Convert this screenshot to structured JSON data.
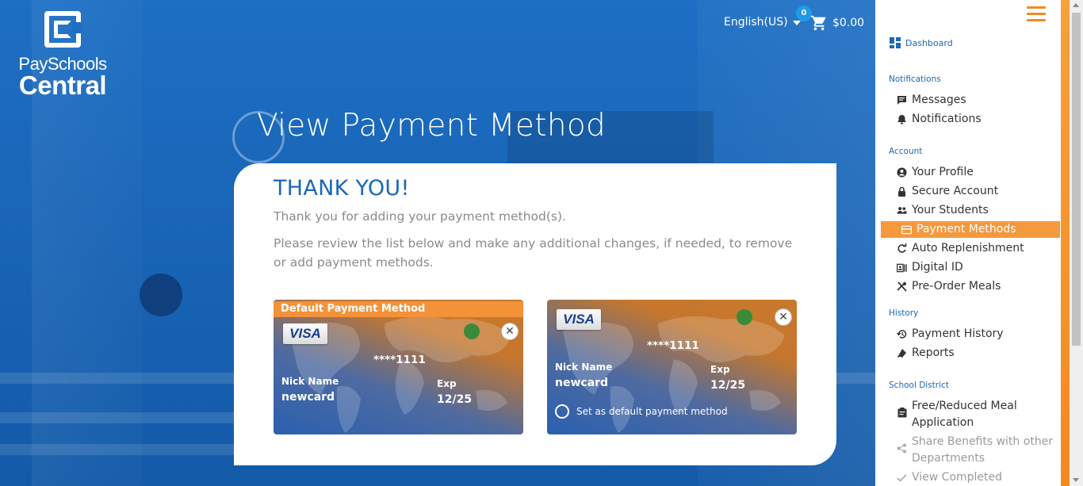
{
  "app": {
    "logo_top": "PaySchools",
    "logo_bottom": "Central"
  },
  "header": {
    "language": "English(US)",
    "cart_count": "0",
    "cart_total": "$0.00"
  },
  "page": {
    "title": "View Payment Method",
    "thank_you_title": "THANK YOU!",
    "thank_you_line1": "Thank you for adding your payment method(s).",
    "thank_you_line2": "Please review the list below and make any additional changes, if needed, to remove or add payment methods."
  },
  "cards": [
    {
      "default_label": "Default Payment Method",
      "brand": "VISA",
      "masked_number": "****1111",
      "nickname_label": "Nick Name",
      "nickname": "newcard",
      "exp_label": "Exp",
      "exp": "12/25",
      "is_default": true
    },
    {
      "brand": "VISA",
      "masked_number": "****1111",
      "nickname_label": "Nick Name",
      "nickname": "newcard",
      "exp_label": "Exp",
      "exp": "12/25",
      "set_default_label": "Set as default payment method",
      "is_default": false
    }
  ],
  "sidebar": {
    "dashboard": "Dashboard",
    "sections": {
      "notifications": "Notifications",
      "account": "Account",
      "history": "History",
      "school_district": "School District"
    },
    "notifications_items": [
      {
        "label": "Messages",
        "icon": "message-icon"
      },
      {
        "label": "Notifications",
        "icon": "bell-icon"
      }
    ],
    "account_items": [
      {
        "label": "Your Profile",
        "icon": "user-circle-icon"
      },
      {
        "label": "Secure Account",
        "icon": "lock-icon"
      },
      {
        "label": "Your Students",
        "icon": "people-icon"
      },
      {
        "label": "Payment Methods",
        "icon": "credit-card-icon",
        "active": true
      },
      {
        "label": "Auto Replenishment",
        "icon": "refresh-icon"
      },
      {
        "label": "Digital ID",
        "icon": "id-card-icon"
      },
      {
        "label": "Pre-Order Meals",
        "icon": "utensils-icon"
      }
    ],
    "history_items": [
      {
        "label": "Payment History",
        "icon": "history-icon"
      },
      {
        "label": "Reports",
        "icon": "report-icon"
      }
    ],
    "district_items": [
      {
        "label": "Free/Reduced Meal Application",
        "icon": "clipboard-icon"
      },
      {
        "label": "Share Benefits with other Departments",
        "icon": "share-icon",
        "muted": true
      },
      {
        "label": "View Completed Application",
        "icon": "check-icon",
        "muted": true
      }
    ]
  },
  "colors": {
    "brand_blue": "#1a67b8",
    "accent_orange": "#f4993e",
    "card_orange": "#c8782a"
  }
}
